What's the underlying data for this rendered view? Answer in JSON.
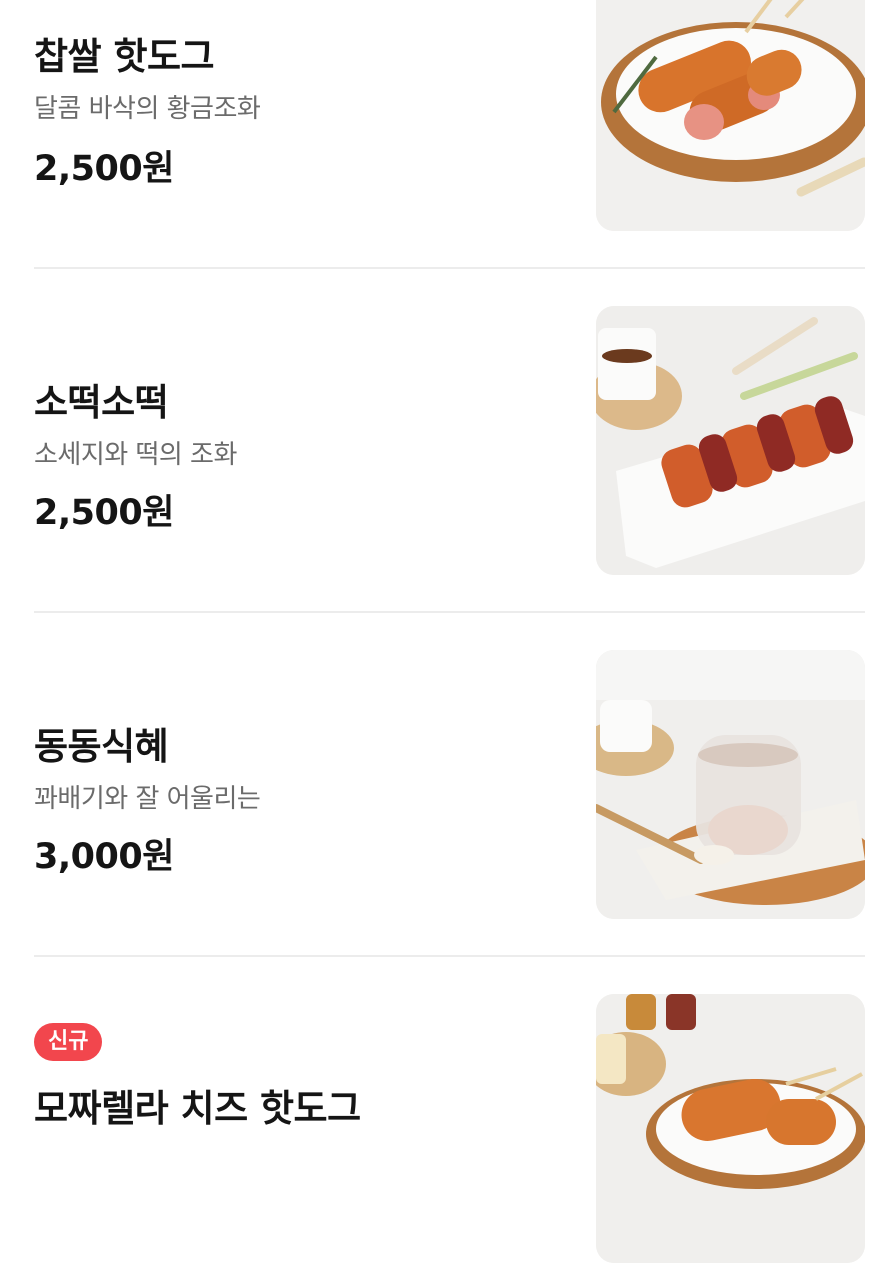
{
  "menu": {
    "items": [
      {
        "name": "찹쌀 핫도그",
        "description": "달콤 바삭의 황금조화",
        "price": "2,500원",
        "image_icon": "rice-hotdog-photo"
      },
      {
        "name": "소떡소떡",
        "description": "소세지와 떡의 조화",
        "price": "2,500원",
        "image_icon": "sotteok-photo"
      },
      {
        "name": "동동식혜",
        "description": "꽈배기와 잘 어울리는",
        "price": "3,000원",
        "image_icon": "sikhye-photo"
      },
      {
        "badge": "신규",
        "name": "모짜렐라 치즈 핫도그",
        "image_icon": "mozzarella-hotdog-photo"
      }
    ]
  }
}
